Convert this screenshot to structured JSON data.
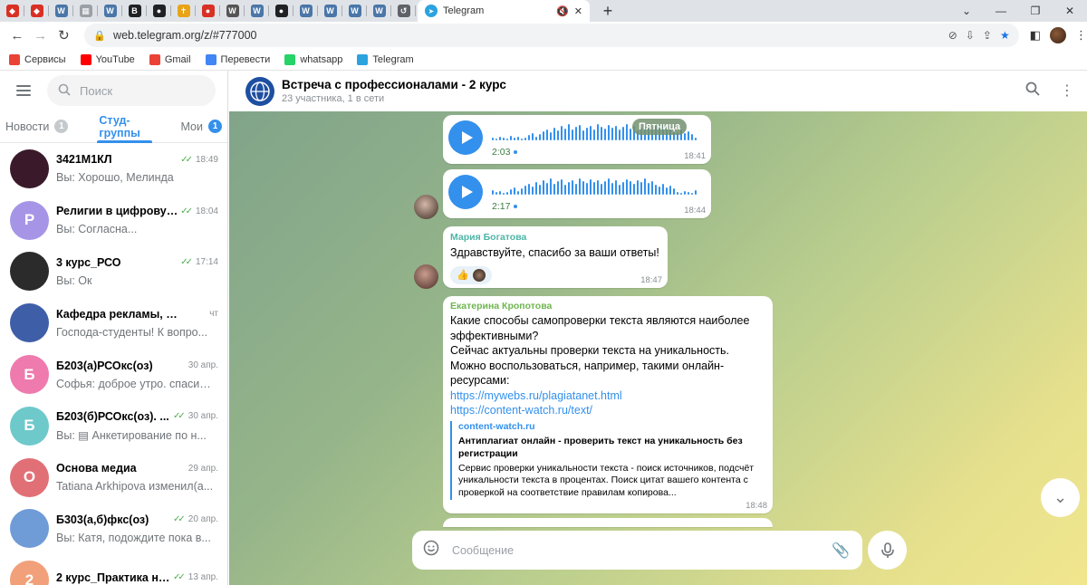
{
  "browser": {
    "mini_tabs": [
      {
        "icon": "red-diamond-icon",
        "color": "#d93025",
        "glyph": "◆"
      },
      {
        "icon": "red-diamond-icon",
        "color": "#d93025",
        "glyph": "◆"
      },
      {
        "icon": "vk-icon",
        "color": "#4a76a8",
        "glyph": "W"
      },
      {
        "icon": "grid-icon",
        "color": "#9aa0a6",
        "glyph": "▦"
      },
      {
        "icon": "vk-icon",
        "color": "#4a76a8",
        "glyph": "W"
      },
      {
        "icon": "letter-b-icon",
        "color": "#202124",
        "glyph": "B"
      },
      {
        "icon": "globe-icon",
        "color": "#202124",
        "glyph": "●"
      },
      {
        "icon": "cross-icon",
        "color": "#e8a317",
        "glyph": "✝"
      },
      {
        "icon": "red-circle-icon",
        "color": "#d93025",
        "glyph": "●"
      },
      {
        "icon": "wikipedia-icon",
        "color": "#555555",
        "glyph": "W"
      },
      {
        "icon": "vk-icon",
        "color": "#4a76a8",
        "glyph": "W"
      },
      {
        "icon": "globe-icon",
        "color": "#202124",
        "glyph": "●"
      },
      {
        "icon": "vk-icon",
        "color": "#4a76a8",
        "glyph": "W"
      },
      {
        "icon": "vk-icon",
        "color": "#4a76a8",
        "glyph": "W"
      },
      {
        "icon": "vk-icon",
        "color": "#4a76a8",
        "glyph": "W"
      },
      {
        "icon": "vk-icon",
        "color": "#4a76a8",
        "glyph": "W"
      },
      {
        "icon": "history-icon",
        "color": "#5f6368",
        "glyph": "↺"
      }
    ],
    "active_tab_title": "Telegram",
    "url": "web.telegram.org/z/#777000",
    "bookmarks": [
      {
        "label": "Сервисы",
        "icon": "apps-grid-icon",
        "color": "#ea4335"
      },
      {
        "label": "YouTube",
        "icon": "youtube-icon",
        "color": "#ff0000"
      },
      {
        "label": "Gmail",
        "icon": "gmail-icon",
        "color": "#ea4335"
      },
      {
        "label": "Перевести",
        "icon": "translate-icon",
        "color": "#4285f4"
      },
      {
        "label": "whatsapp",
        "icon": "whatsapp-icon",
        "color": "#25d366"
      },
      {
        "label": "Telegram",
        "icon": "telegram-icon",
        "color": "#2aa3df"
      }
    ]
  },
  "sidebar": {
    "search_placeholder": "Поиск",
    "folders": [
      {
        "label": "Новости",
        "count": "1",
        "active": false
      },
      {
        "label": "Студ-группы",
        "count": "",
        "active": true
      },
      {
        "label": "Мои",
        "count": "1",
        "active": false
      }
    ],
    "chats": [
      {
        "name": "3421M1КЛ",
        "time": "18:49",
        "read": true,
        "preview": "Вы: Хорошо, Мелинда",
        "avatar_letter": "",
        "avatar_color": "#3a1a2a"
      },
      {
        "name": "Религии в цифровую...",
        "time": "18:04",
        "read": true,
        "preview": "Вы: Согласна...",
        "avatar_letter": "Р",
        "avatar_color": "#a695e7"
      },
      {
        "name": "3 курс_РСО",
        "time": "17:14",
        "read": true,
        "preview": "Вы: Ок",
        "avatar_letter": "",
        "avatar_color": "#2b2b2b"
      },
      {
        "name": "Кафедра рекламы, св...",
        "time": "чт",
        "read": false,
        "preview": "Господа-студенты! К вопро...",
        "avatar_letter": "",
        "avatar_color": "#3f5ea8"
      },
      {
        "name": "Б203(а)РСОкс(оз)",
        "time": "30 апр.",
        "read": false,
        "preview": "Софья: доброе утро. спасиб...",
        "avatar_letter": "Б",
        "avatar_color": "#ee7aae"
      },
      {
        "name": "Б203(б)РСОкс(оз). ...",
        "time": "30 апр.",
        "read": true,
        "preview": "Вы: ▤ Анкетирование по н...",
        "avatar_letter": "Б",
        "avatar_color": "#6ec9cb"
      },
      {
        "name": "Основа медиа",
        "time": "29 апр.",
        "read": false,
        "preview": "Tatiana Arkhipova изменил(а...",
        "avatar_letter": "О",
        "avatar_color": "#e17076"
      },
      {
        "name": "Б303(а,б)фкс(оз)",
        "time": "20 апр.",
        "read": true,
        "preview": "Вы: Катя, подождите пока в...",
        "avatar_letter": "",
        "avatar_color": "#6f9bd6"
      },
      {
        "name": "2 курс_Практика на...",
        "time": "13 апр.",
        "read": true,
        "preview": "",
        "avatar_letter": "2",
        "avatar_color": "#f1a07a"
      }
    ]
  },
  "chat": {
    "title": "Встреча с профессионалами - 2 курс",
    "subtitle": "23 участника, 1 в сети",
    "date_label": "Пятница",
    "voice_messages": [
      {
        "duration": "2:03",
        "time": "18:41"
      },
      {
        "duration": "2:17",
        "time": "18:44"
      }
    ],
    "messages": [
      {
        "sender": "Мария Богатова",
        "text": "Здравствуйте, спасибо за ваши ответы!",
        "reaction": "👍",
        "time": "18:47"
      },
      {
        "sender": "Екатерина Кропотова",
        "text": "Какие способы самопроверки текста являются наиболее эффективными?\nСейчас актуальны проверки текста на уникальность. Можно воспользоваться, например, такими онлайн-ресурсами:",
        "links": [
          "https://mywebs.ru/plagiatanet.html",
          "https://content-watch.ru/text/"
        ],
        "preview_site": "content-watch.ru",
        "preview_title": "Антиплагиат онлайн - проверить текст на уникальность без регистрации",
        "preview_desc": "Сервис проверки уникальности текста - поиск источников, подсчёт уникальности текста в процентах. Поиск цитат вашего контента с проверкой на соответствие правилам копирова...",
        "time": "18:48"
      }
    ],
    "composer_placeholder": "Сообщение"
  }
}
